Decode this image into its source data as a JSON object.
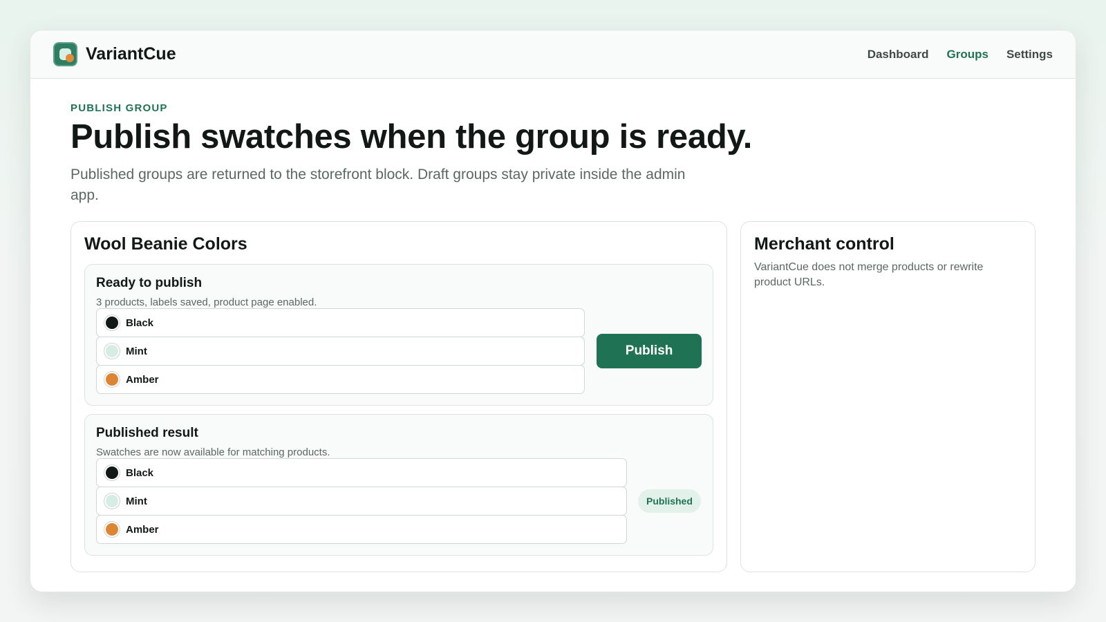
{
  "app": {
    "name": "VariantCue",
    "logo_icon": "variantcue-logo-icon"
  },
  "nav": {
    "items": [
      {
        "label": "Dashboard",
        "active": false
      },
      {
        "label": "Groups",
        "active": true
      },
      {
        "label": "Settings",
        "active": false
      }
    ]
  },
  "header": {
    "eyebrow": "PUBLISH GROUP",
    "title": "Publish swatches when the group is ready.",
    "subtitle": "Published groups are returned to the storefront block. Draft groups stay private inside the admin app."
  },
  "group": {
    "name": "Wool Beanie Colors",
    "ready": {
      "title": "Ready to publish",
      "subtitle": "3 products, labels saved, product page enabled.",
      "swatches": [
        {
          "label": "Black",
          "color": "#111816"
        },
        {
          "label": "Mint",
          "color": "#d6ede4"
        },
        {
          "label": "Amber",
          "color": "#dc8634"
        }
      ],
      "button_label": "Publish"
    },
    "result": {
      "title": "Published result",
      "subtitle": "Swatches are now available for matching products.",
      "swatches": [
        {
          "label": "Black",
          "color": "#111816"
        },
        {
          "label": "Mint",
          "color": "#d6ede4"
        },
        {
          "label": "Amber",
          "color": "#dc8634"
        }
      ],
      "badge": "Published"
    }
  },
  "side": {
    "title": "Merchant control",
    "text": "VariantCue does not merge products or rewrite product URLs."
  },
  "colors": {
    "accent": "#1f7354",
    "badge_bg": "#e2f1ea"
  }
}
